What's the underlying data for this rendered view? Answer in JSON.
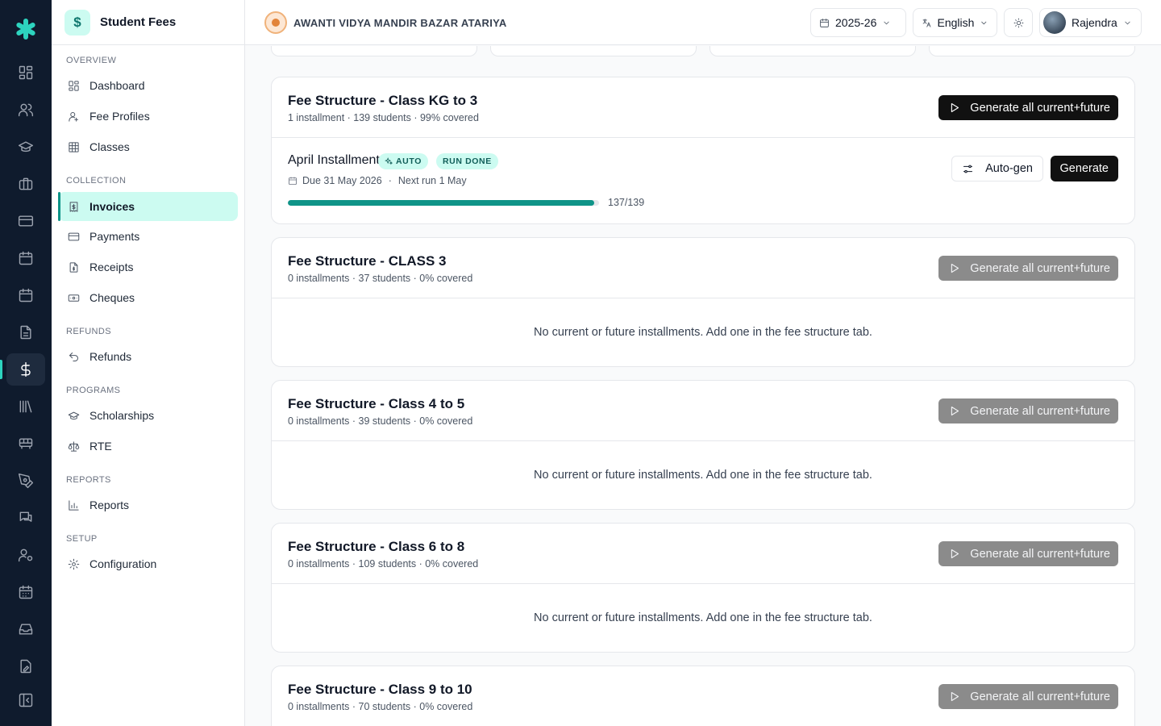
{
  "colors": {
    "accent": "#0d9488",
    "rail_bg": "#0f1b2d",
    "badge_bg": "#ccfbf1",
    "primary_button": "#111111"
  },
  "rail": {
    "icons": [
      "app-logo-icon",
      "dashboard-icon",
      "users-icon",
      "graduation-cap-icon",
      "briefcase-icon",
      "credit-card-icon",
      "calendar-icon",
      "calendar-check-icon",
      "file-text-icon",
      "dollar-icon",
      "library-icon",
      "bus-icon",
      "pen-tool-icon",
      "chat-icon",
      "user-cog-icon",
      "calendar-grid-icon",
      "inbox-icon",
      "document-edit-icon",
      "collapse-sidebar-icon"
    ]
  },
  "sidebar": {
    "title": "Student Fees",
    "app_icon": "$",
    "sections": {
      "overview": "OVERVIEW",
      "collection": "COLLECTION",
      "refunds": "REFUNDS",
      "programs": "PROGRAMS",
      "reports": "REPORTS",
      "setup": "SETUP"
    },
    "items": {
      "dashboard": "Dashboard",
      "fee_profiles": "Fee Profiles",
      "classes": "Classes",
      "invoices": "Invoices",
      "payments": "Payments",
      "receipts": "Receipts",
      "cheques": "Cheques",
      "refunds": "Refunds",
      "scholarships": "Scholarships",
      "rte": "RTE",
      "reports": "Reports",
      "configuration": "Configuration"
    },
    "active_item": "Invoices"
  },
  "topbar": {
    "school_name": "AWANTI VIDYA MANDIR BAZAR ATARIYA",
    "year": "2025-26",
    "language": "English",
    "user": "Rajendra"
  },
  "cards": [
    {
      "title": "Fee Structure - Class KG to 3",
      "subtitle": "1 installment · 139 students · 99% covered",
      "button": "Generate all current+future",
      "installment": {
        "name": "April Installment",
        "badge_auto": "AUTO",
        "badge_run": "RUN DONE",
        "due": "Due 31 May 2026",
        "separator": "·",
        "next_run": "Next run 1 May",
        "progress_done": 137,
        "progress_total": 139,
        "progress_label": "137/139",
        "autogen_label": "Auto-gen",
        "generate_label": "Generate"
      }
    },
    {
      "title": "Fee Structure - CLASS 3",
      "subtitle": "0 installments · 37 students · 0% covered",
      "button": "Generate all current+future",
      "empty": "No current or future installments. Add one in the fee structure tab."
    },
    {
      "title": "Fee Structure - Class 4 to 5",
      "subtitle": "0 installments · 39 students · 0% covered",
      "button": "Generate all current+future",
      "empty": "No current or future installments. Add one in the fee structure tab."
    },
    {
      "title": "Fee Structure - Class 6 to 8",
      "subtitle": "0 installments · 109 students · 0% covered",
      "button": "Generate all current+future",
      "empty": "No current or future installments. Add one in the fee structure tab."
    },
    {
      "title": "Fee Structure - Class 9 to 10",
      "subtitle": "0 installments · 70 students · 0% covered",
      "button": "Generate all current+future"
    }
  ]
}
